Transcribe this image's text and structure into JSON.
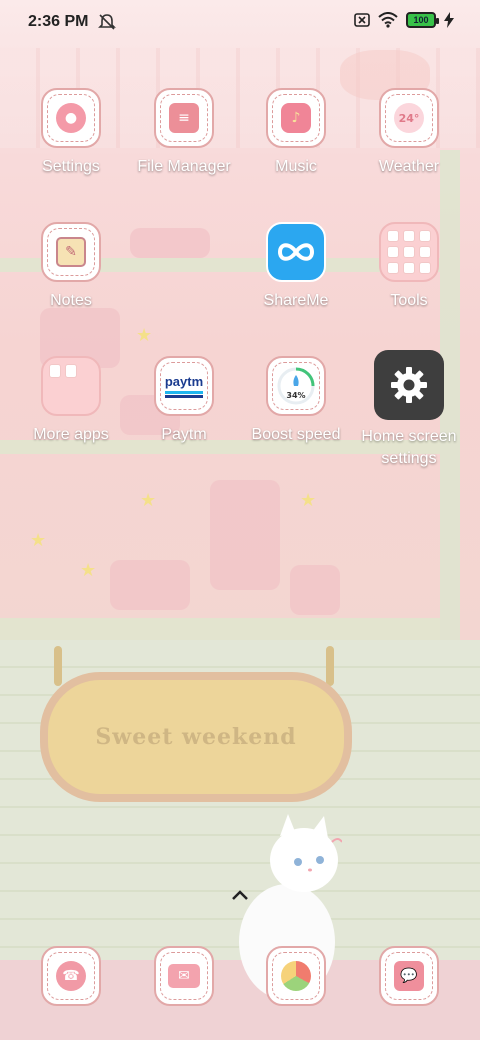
{
  "status_bar": {
    "time": "2:36 PM",
    "battery_level": "100",
    "icons": [
      "dnd-off-icon",
      "sim-x-icon",
      "wifi-icon",
      "battery-icon",
      "charging-icon"
    ]
  },
  "apps_row1": [
    {
      "label": "Settings",
      "icon": "donut-icon"
    },
    {
      "label": "File Manager",
      "icon": "notebook-icon"
    },
    {
      "label": "Music",
      "icon": "music-note-icon"
    },
    {
      "label": "Weather",
      "icon": "weather-icon",
      "temp": "24°"
    }
  ],
  "apps_row2": [
    {
      "label": "Notes",
      "icon": "notes-icon"
    },
    {
      "label": "ShareMe",
      "icon": "infinity-icon"
    },
    {
      "label": "Tools",
      "icon": "folder-icon"
    }
  ],
  "apps_row3": [
    {
      "label": "More apps",
      "icon": "folder-icon"
    },
    {
      "label": "Paytm",
      "icon": "paytm-icon",
      "brand": "paytm"
    },
    {
      "label": "Boost speed",
      "icon": "rocket-icon",
      "percent": "34%"
    },
    {
      "label": "Home screen settings",
      "label_line1": "Home screen",
      "label_line2": "settings",
      "icon": "gear-icon"
    }
  ],
  "dock": [
    {
      "name": "phone",
      "icon": "phone-bunny-icon"
    },
    {
      "name": "messages",
      "icon": "bunny-card-icon"
    },
    {
      "name": "browser",
      "icon": "browser-ball-icon"
    },
    {
      "name": "chat",
      "icon": "chat-bubbles-icon"
    }
  ],
  "wallpaper": {
    "sign_text": "Sweet weekend"
  },
  "colors": {
    "icon_border": "#e2a8a8",
    "accent_pink": "#f0a6b2",
    "shareme_blue": "#2ba7f0",
    "settings_dark": "#3e3e3e"
  }
}
